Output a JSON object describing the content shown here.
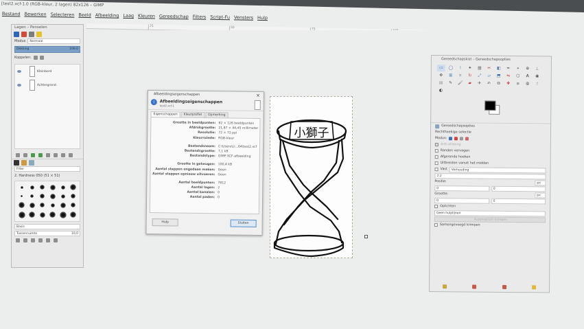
{
  "window": {
    "title": "[test2.xcf-1.0 (RGB-kleur, 2 lagen) 82x126 – GIMP"
  },
  "menubar": [
    "Bestand",
    "Bewerken",
    "Selecteren",
    "Beeld",
    "Afbeelding",
    "Laag",
    "Kleuren",
    "Gereedschap",
    "Filters",
    "Script-Fu",
    "Vensters",
    "Hulp"
  ],
  "ruler": [
    "25",
    "50",
    "75",
    "100",
    "125"
  ],
  "layers_dock": {
    "title": "Lagen – Penselen",
    "mode_label": "Modus",
    "mode_value": "Normaal",
    "opacity_label": "Dekking",
    "opacity_value": "100,0",
    "lock_label": "Koppelen:",
    "layers": [
      {
        "name": "Kleinbord"
      },
      {
        "name": "Achtergrond"
      }
    ],
    "brush_filter": "Filter",
    "brush_name": "2. Hardness 050 (51 × 51)",
    "brush_spacing_label": "Basis",
    "brush_spacing_field": "Tussenruimte",
    "brush_spacing_value": "10,0"
  },
  "dialog": {
    "title": "Afbeeldingseigenschappen",
    "heading": "Afbeeldingseigenschappen",
    "subheading": "test2.xcf-1",
    "tabs": [
      "Eigenschappen",
      "Kleurprofiel",
      "Opmerking"
    ],
    "groups": [
      [
        {
          "k": "Grootte in beeldpunten:",
          "v": "82 × 126 beeldpunten"
        },
        {
          "k": "Afdrukgrootte:",
          "v": "21,87 × 44,45 millimeters"
        },
        {
          "k": "Resolutie:",
          "v": "72 × 72 ppi"
        },
        {
          "k": "Kleurruimte:",
          "v": "RGB-kleur"
        }
      ],
      [
        {
          "k": "Bestandsnaam:",
          "v": "C:\\Users\\Li...64\\test2.xcf"
        },
        {
          "k": "Bestandsgrootte:",
          "v": "7,1 kB"
        },
        {
          "k": "Bestandstype:",
          "v": "GIMP XCF-afbeelding"
        }
      ],
      [
        {
          "k": "Grootte in geheugen:",
          "v": "100,4 kB"
        },
        {
          "k": "Aantal stappen ongedaan maken:",
          "v": "Geen"
        },
        {
          "k": "Aantal stappen opnieuw uitvoeren:",
          "v": "Geen"
        }
      ],
      [
        {
          "k": "Aantal beeldpunten:",
          "v": "7812"
        },
        {
          "k": "Aantal lagen:",
          "v": "2"
        },
        {
          "k": "Aantal kanalen:",
          "v": "0"
        },
        {
          "k": "Aantal paden:",
          "v": "0"
        }
      ]
    ],
    "help_label": "Hulp",
    "close_label": "Sluiten"
  },
  "image": {
    "sign_text": "小獅子"
  },
  "toolbox": {
    "title": "Gereedschapskist – Gereedschapsopties",
    "options_tab": "Gereedschapsopties",
    "tool_name": "Rechthoekige selectie",
    "mode_label": "Modus:",
    "options": [
      "Anti-aliasing",
      "Randen vervagen",
      "Afgeronde hoeken",
      "Uitbreiden vanuit het midden"
    ],
    "fixed_label": "Vast",
    "fixed_value": "Verhouding",
    "ratio_value": "2:2",
    "position_label": "Positie:",
    "position_unit": "px",
    "size_label": "Grootte:",
    "size_unit": "px",
    "highlight_label": "Oplichten",
    "guides_value": "Geen hulplijnen",
    "autoshrink_label": "Automatisch krimpen",
    "shrink_merged_label": "Samengevoegd krimpen"
  },
  "colors": {
    "fg": "#000000",
    "bg": "#ffffff",
    "accent": "#7aa0c8"
  }
}
